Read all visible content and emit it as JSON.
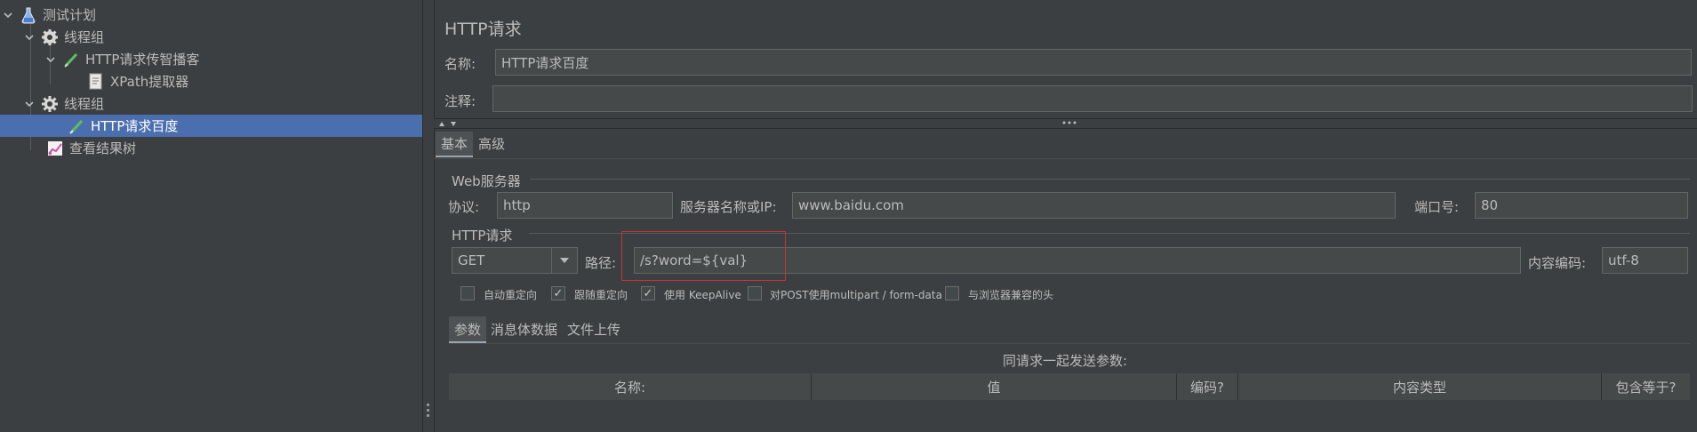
{
  "tree": {
    "items": [
      {
        "label": "测试计划",
        "icon": "flask-icon"
      },
      {
        "label": "线程组",
        "icon": "gear-icon"
      },
      {
        "label": "HTTP请求传智播客",
        "icon": "pipette-icon"
      },
      {
        "label": "XPath提取器",
        "icon": "document-icon"
      },
      {
        "label": "线程组",
        "icon": "gear-icon"
      },
      {
        "label": "HTTP请求百度",
        "icon": "pipette-icon"
      },
      {
        "label": "查看结果树",
        "icon": "chart-icon"
      }
    ]
  },
  "panel": {
    "title": "HTTP请求",
    "name_label": "名称:",
    "name_value": "HTTP请求百度",
    "comment_label": "注释:",
    "comment_value": ""
  },
  "main_tabs": [
    "基本",
    "高级"
  ],
  "web_server": {
    "section_title": "Web服务器",
    "protocol_label": "协议:",
    "protocol_value": "http",
    "server_label": "服务器名称或IP:",
    "server_value": "www.baidu.com",
    "port_label": "端口号:",
    "port_value": "80"
  },
  "http_request": {
    "section_title": "HTTP请求",
    "method": "GET",
    "path_label": "路径:",
    "path_value": "/s?word=${val}",
    "encoding_label": "内容编码:",
    "encoding_value": "utf-8"
  },
  "options": [
    {
      "label": "自动重定向",
      "checked": false
    },
    {
      "label": "跟随重定向",
      "checked": true
    },
    {
      "label": "使用 KeepAlive",
      "checked": true
    },
    {
      "label": "对POST使用multipart / form-data",
      "checked": false
    },
    {
      "label": "与浏览器兼容的头",
      "checked": false
    }
  ],
  "sub_tabs": [
    "参数",
    "消息体数据",
    "文件上传"
  ],
  "params": {
    "caption": "同请求一起发送参数:",
    "columns": [
      "名称:",
      "值",
      "编码?",
      "内容类型",
      "包含等于?"
    ]
  },
  "colors": {
    "background": "#3c3f41",
    "selection": "#4b6eaf",
    "highlight_box": "#d03030"
  }
}
